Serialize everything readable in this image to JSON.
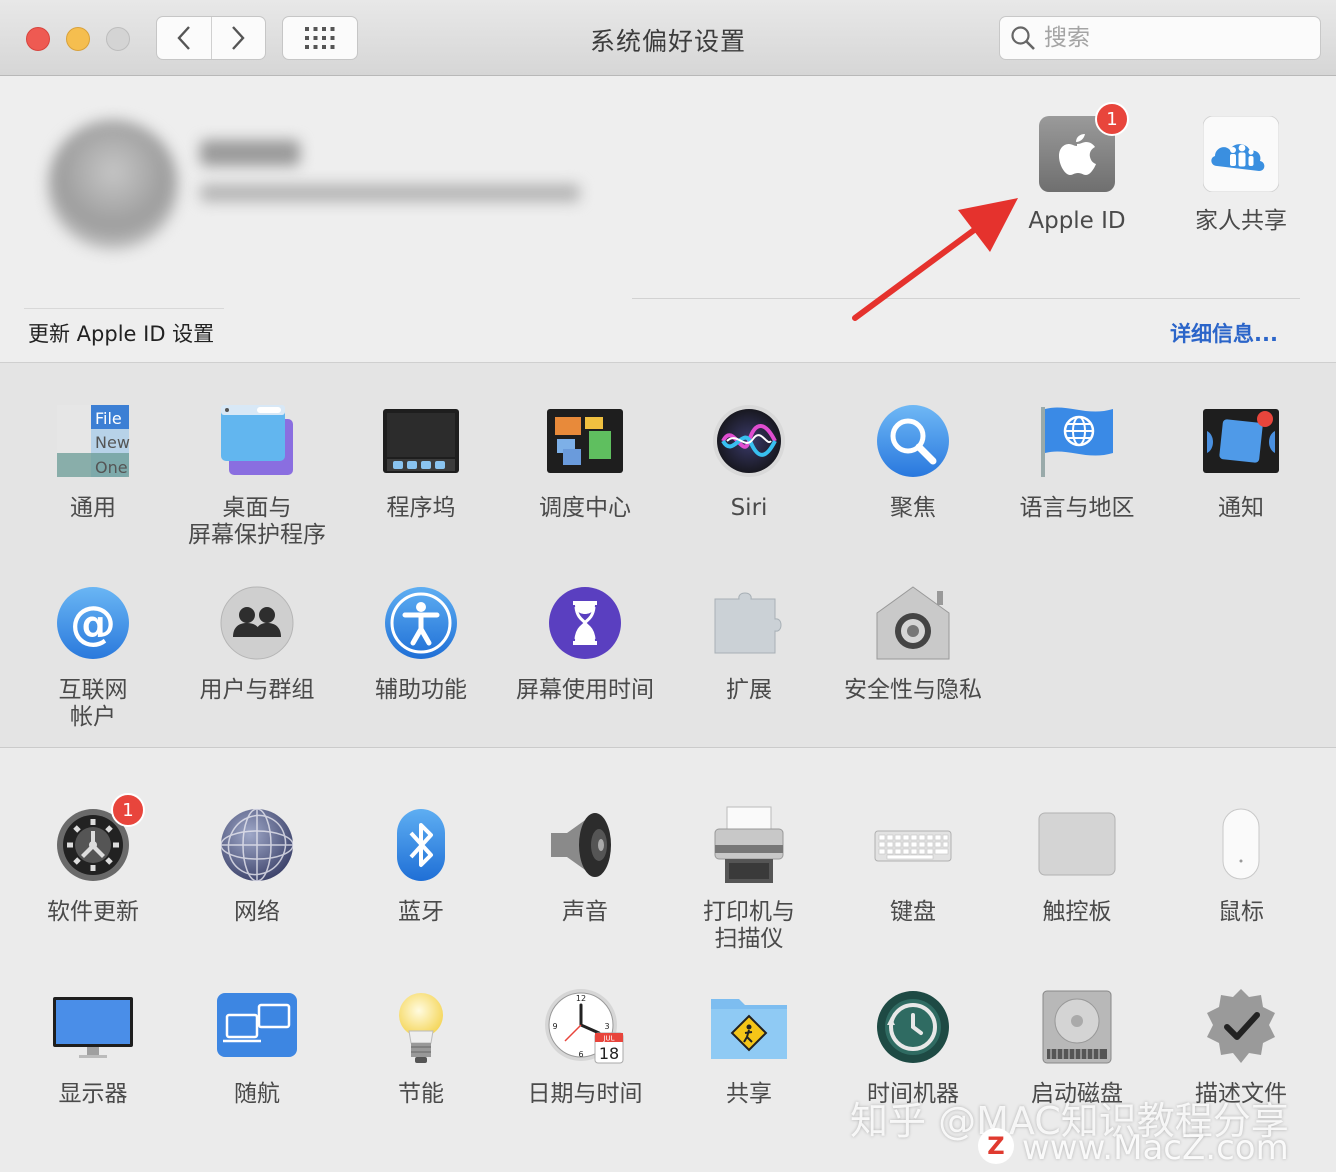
{
  "window": {
    "title": "系统偏好设置"
  },
  "search": {
    "placeholder": "搜索"
  },
  "account": {
    "update_message": "更新 Apple ID 设置",
    "details_link": "详细信息...",
    "apple_id": {
      "label": "Apple ID",
      "badge": "1"
    },
    "family": {
      "label": "家人共享"
    }
  },
  "section_main": [
    {
      "id": "general",
      "label": "通用",
      "icon": "general-icon",
      "icon_text": [
        "File",
        "New",
        "One"
      ]
    },
    {
      "id": "desktop",
      "label": "桌面与\n屏幕保护程序",
      "icon": "desktop-screensaver-icon"
    },
    {
      "id": "dock",
      "label": "程序坞",
      "icon": "dock-icon"
    },
    {
      "id": "mission",
      "label": "调度中心",
      "icon": "mission-control-icon"
    },
    {
      "id": "siri",
      "label": "Siri",
      "icon": "siri-icon"
    },
    {
      "id": "spotlight",
      "label": "聚焦",
      "icon": "spotlight-icon"
    },
    {
      "id": "language",
      "label": "语言与地区",
      "icon": "language-region-icon"
    },
    {
      "id": "notifications",
      "label": "通知",
      "icon": "notifications-icon"
    },
    {
      "id": "internet",
      "label": "互联网\n帐户",
      "icon": "internet-accounts-icon"
    },
    {
      "id": "users",
      "label": "用户与群组",
      "icon": "users-groups-icon"
    },
    {
      "id": "accessibility",
      "label": "辅助功能",
      "icon": "accessibility-icon"
    },
    {
      "id": "screentime",
      "label": "屏幕使用时间",
      "icon": "screen-time-icon"
    },
    {
      "id": "extensions",
      "label": "扩展",
      "icon": "extensions-icon"
    },
    {
      "id": "security",
      "label": "安全性与隐私",
      "icon": "security-privacy-icon"
    }
  ],
  "section_hardware": [
    {
      "id": "softwareupdate",
      "label": "软件更新",
      "icon": "software-update-icon",
      "badge": "1"
    },
    {
      "id": "network",
      "label": "网络",
      "icon": "network-icon"
    },
    {
      "id": "bluetooth",
      "label": "蓝牙",
      "icon": "bluetooth-icon"
    },
    {
      "id": "sound",
      "label": "声音",
      "icon": "sound-icon"
    },
    {
      "id": "printers",
      "label": "打印机与\n扫描仪",
      "icon": "printers-scanners-icon"
    },
    {
      "id": "keyboard",
      "label": "键盘",
      "icon": "keyboard-icon"
    },
    {
      "id": "trackpad",
      "label": "触控板",
      "icon": "trackpad-icon"
    },
    {
      "id": "mouse",
      "label": "鼠标",
      "icon": "mouse-icon"
    },
    {
      "id": "displays",
      "label": "显示器",
      "icon": "displays-icon"
    },
    {
      "id": "sidecar",
      "label": "随航",
      "icon": "sidecar-icon"
    },
    {
      "id": "energy",
      "label": "节能",
      "icon": "energy-saver-icon"
    },
    {
      "id": "datetime",
      "label": "日期与时间",
      "icon": "date-time-icon",
      "icon_text": [
        "JUL",
        "18"
      ]
    },
    {
      "id": "sharing",
      "label": "共享",
      "icon": "sharing-icon"
    },
    {
      "id": "timemachine",
      "label": "时间机器",
      "icon": "time-machine-icon"
    },
    {
      "id": "startup",
      "label": "启动磁盘",
      "icon": "startup-disk-icon"
    },
    {
      "id": "profiles",
      "label": "描述文件",
      "icon": "profiles-icon"
    }
  ],
  "watermark": {
    "line1": "知乎 @MAC知识教程分享",
    "line2": "www.MacZ.com",
    "logo": "Z"
  },
  "colors": {
    "accent": "#2b65c9",
    "badge": "#e8453c",
    "arrow": "#e5322d"
  }
}
